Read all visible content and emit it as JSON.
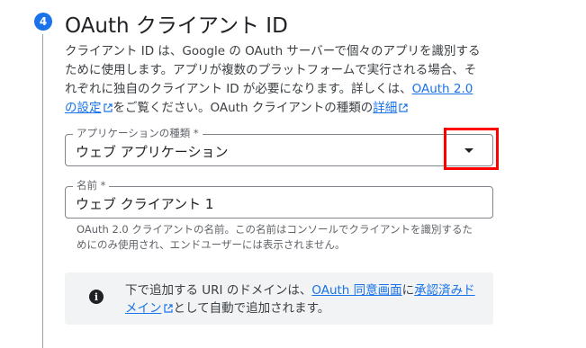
{
  "step": {
    "number": "4",
    "title": "OAuth クライアント ID"
  },
  "description": {
    "text1": "クライアント ID は、Google の OAuth サーバーで個々のアプリを識別するために使用します。アプリが複数のプラットフォームで実行される場合、それぞれに独自のクライアント ID が必要になります。詳しくは、",
    "link1": "OAuth 2.0 の設定",
    "text2": "をご覧ください。OAuth クライアントの種類の",
    "link2": "詳細"
  },
  "app_type": {
    "label": "アプリケーションの種類 *",
    "value": "ウェブ アプリケーション"
  },
  "name": {
    "label": "名前 *",
    "value": "ウェブ クライアント 1",
    "helper": "OAuth 2.0 クライアントの名前。この名前はコンソールでクライアントを識別するためにのみ使用され、エンドユーザーには表示されません。"
  },
  "info": {
    "text1": "下で追加する URI のドメインは、",
    "link1": "OAuth 同意画面",
    "text2": "に",
    "link2": "承認済みドメイン",
    "text3": "として自動で追加されます。"
  },
  "icons": {
    "step": "step-number-badge",
    "dropdown": "dropdown-arrow-icon",
    "external": "open-in-new-icon",
    "info": "info-icon"
  },
  "colors": {
    "accent": "#1a73e8",
    "highlight": "#ff0000",
    "info_bg": "#f1f3f4"
  }
}
